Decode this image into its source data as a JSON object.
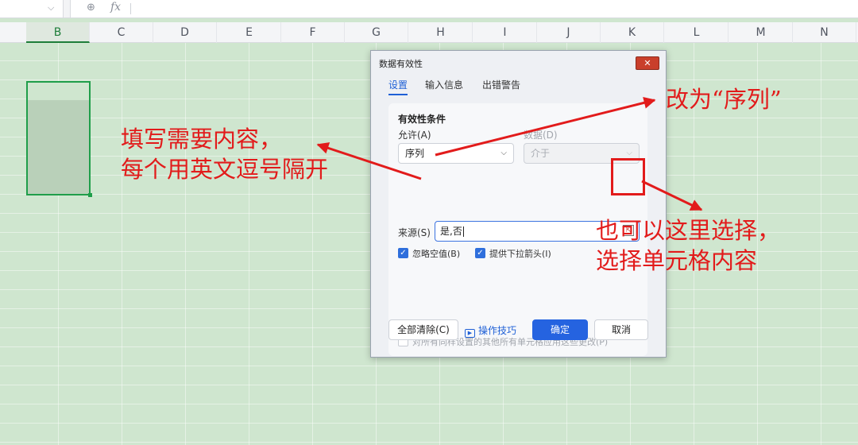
{
  "formula_bar": {
    "zoom_icon": "zoom-icon",
    "fx_label": "fx"
  },
  "columns": [
    "B",
    "C",
    "D",
    "E",
    "F",
    "G",
    "H",
    "I",
    "J",
    "K",
    "L",
    "M",
    "N"
  ],
  "active_column": "B",
  "dialog": {
    "title": "数据有效性",
    "close_label": "✕",
    "tabs": [
      "设置",
      "输入信息",
      "出错警告"
    ],
    "active_tab": "设置",
    "section_title": "有效性条件",
    "allow_label": "允许(A)",
    "allow_value": "序列",
    "data_label": "数据(D)",
    "data_value": "介于",
    "source_label": "来源(S)",
    "source_value": "是,否",
    "ignore_blank_label": "忽略空值(B)",
    "ignore_blank_checked": true,
    "dropdown_label": "提供下拉箭头(I)",
    "dropdown_checked": true,
    "apply_all_label": "对所有同样设置的其他所有单元格应用这些更改(P)",
    "apply_all_checked": false,
    "clear_all_label": "全部清除(C)",
    "tips_label": "操作技巧",
    "ok_label": "确定",
    "cancel_label": "取消"
  },
  "annotations": {
    "change_to": "改为“序列”",
    "fill_line1": "填写需要内容，",
    "fill_line2": "每个用英文逗号隔开",
    "select_line1": "也可以这里选择，",
    "select_line2": "选择单元格内容"
  },
  "colors": {
    "annotation_red": "#e21b1b",
    "accent_blue": "#2563e0",
    "sheet_green": "#cfe6cf",
    "selection_green": "#1f9e4a"
  }
}
